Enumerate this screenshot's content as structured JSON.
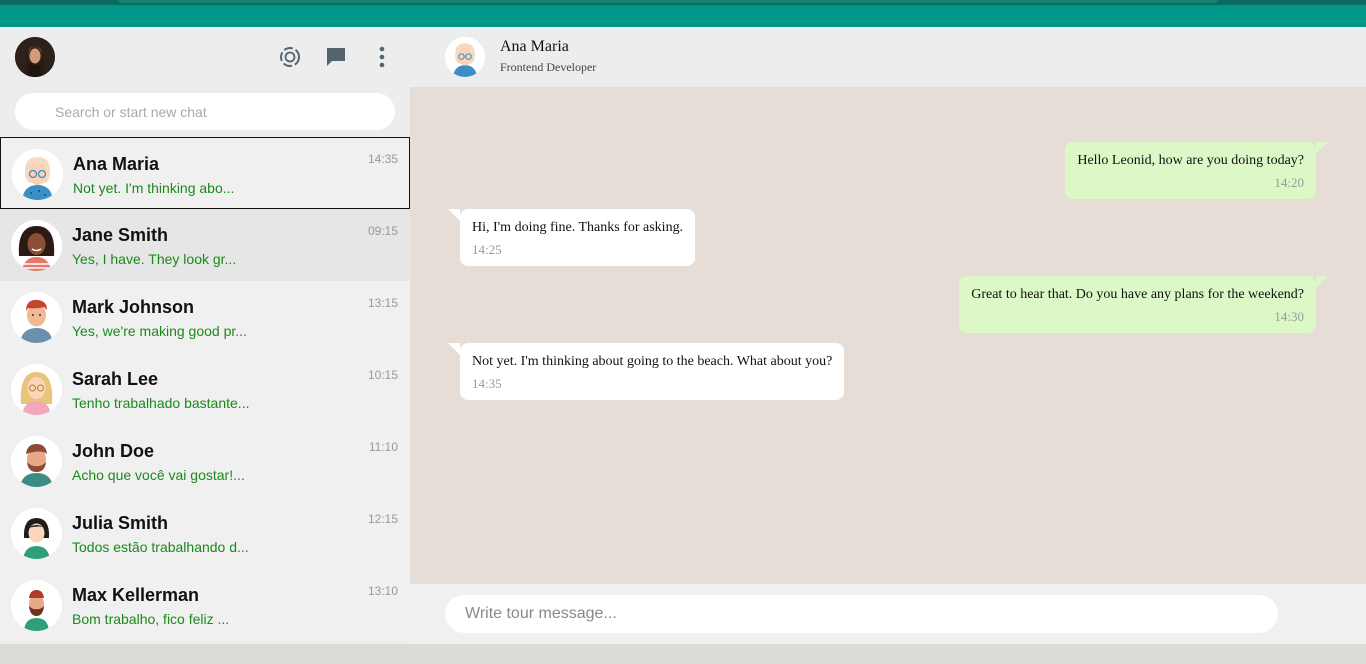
{
  "header": {
    "icons": [
      "status-icon",
      "new-chat-icon",
      "menu-dots-icon"
    ]
  },
  "search": {
    "placeholder": "Search or start new chat"
  },
  "chats": [
    {
      "name": "Ana Maria",
      "message": "Not yet. I'm thinking abo...",
      "time": "14:35"
    },
    {
      "name": "Jane Smith",
      "message": "Yes, I have. They look gr...",
      "time": "09:15"
    },
    {
      "name": "Mark Johnson",
      "message": "Yes, we're making good pr...",
      "time": "13:15"
    },
    {
      "name": "Sarah Lee",
      "message": "Tenho trabalhado bastante...",
      "time": "10:15"
    },
    {
      "name": "John Doe",
      "message": "Acho que você vai gostar!...",
      "time": "11:10"
    },
    {
      "name": "Julia Smith",
      "message": "Todos estão trabalhando d...",
      "time": "12:15"
    },
    {
      "name": "Max Kellerman",
      "message": "Bom trabalho, fico feliz ...",
      "time": "13:10"
    }
  ],
  "conversation": {
    "contact_name": "Ana Maria",
    "contact_role": "Frontend Developer",
    "messages": [
      {
        "direction": "out",
        "text": "Hello Leonid, how are you doing today?",
        "time": "14:20"
      },
      {
        "direction": "in",
        "text": "Hi, I'm doing fine. Thanks for asking.",
        "time": "14:25"
      },
      {
        "direction": "out",
        "text": "Great to hear that. Do you have any plans for the weekend?",
        "time": "14:30"
      },
      {
        "direction": "in",
        "text": "Not yet. I'm thinking about going to the beach. What about you?",
        "time": "14:35"
      }
    ]
  },
  "composer": {
    "placeholder": "Write tour message..."
  },
  "colors": {
    "brand": "#009688",
    "outgoing_bubble": "#dcf8c6",
    "chat_background": "#e5ddd6",
    "preview_text": "#1a8a1a"
  }
}
